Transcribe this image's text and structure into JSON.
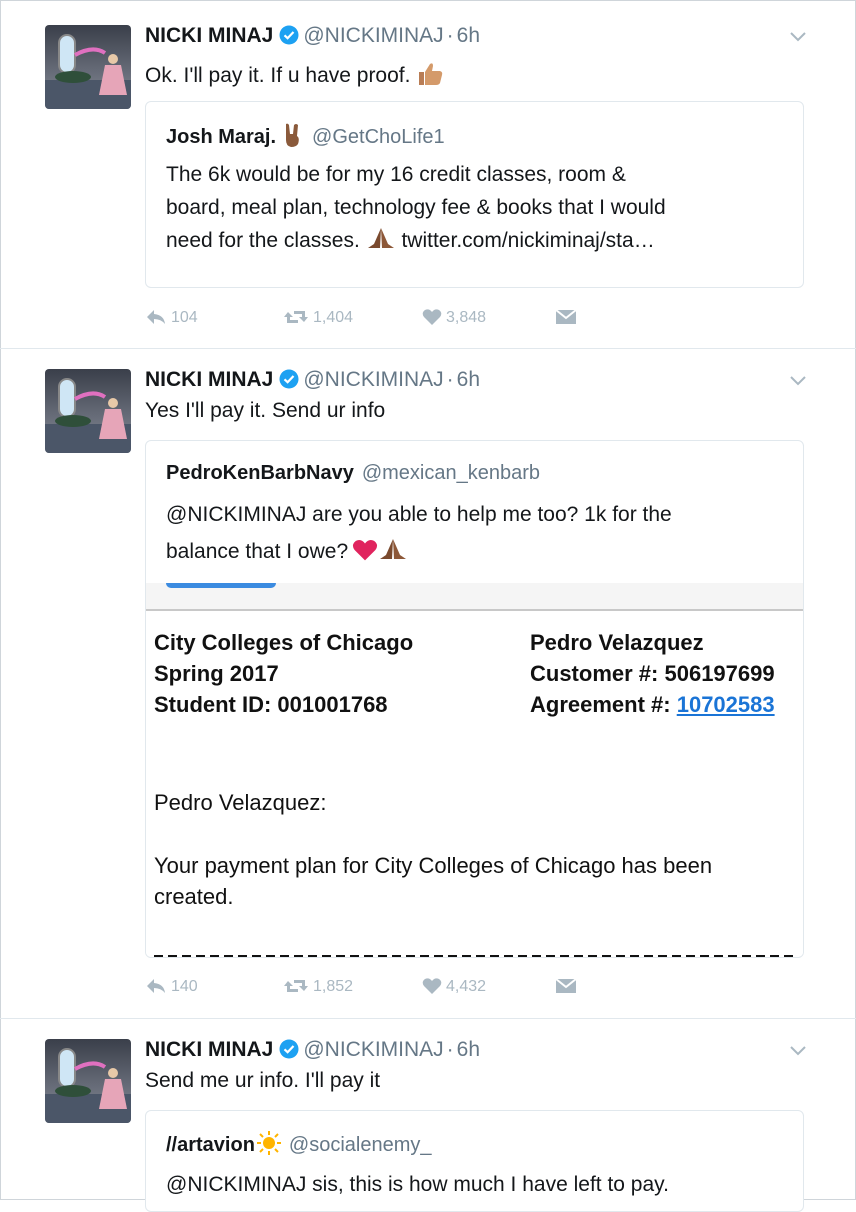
{
  "colors": {
    "verified": "#1da1f2",
    "muted": "#657786",
    "action": "#aab8c2",
    "link": "#1a74d6",
    "heart_red": "#e0245e"
  },
  "tweets": [
    {
      "name": "NICKI MINAJ",
      "handle": "@NICKIMINAJ",
      "dot": "·",
      "time": "6h",
      "text": "Ok. I'll pay it. If u have proof.",
      "emoji": "thumbs-up-icon",
      "quote": {
        "name": "Josh Maraj.",
        "name_emoji": "rock-on-hand-icon",
        "handle": "@GetChoLife1",
        "lines": [
          "The 6k would be for my 16 credit classes, room &",
          "board, meal plan, technology fee & books that I would",
          "need for the classes."
        ],
        "line3_link": "twitter.com/nickiminaj/sta…"
      },
      "replies": "104",
      "retweets": "1,404",
      "likes": "3,848"
    },
    {
      "name": "NICKI MINAJ",
      "handle": "@NICKIMINAJ",
      "dot": "·",
      "time": "6h",
      "text": "Yes I'll pay it. Send ur info",
      "quote": {
        "name": "PedroKenBarbNavy",
        "handle": "@mexican_kenbarb",
        "lines": [
          "@NICKIMINAJ are you able to help me too? 1k for the",
          "balance that I owe?"
        ],
        "doc": {
          "col1": [
            "City Colleges of Chicago",
            "Spring 2017",
            "Student ID: 001001768"
          ],
          "col2_name": "Pedro Velazquez",
          "col2_customer_label": "Customer #:",
          "col2_customer_value": "506197699",
          "col2_agreement_label": "Agreement #:",
          "col2_agreement_value": "10702583",
          "greeting": "Pedro Velazquez:",
          "body": "Your payment plan for City Colleges of Chicago has been created."
        }
      },
      "replies": "140",
      "retweets": "1,852",
      "likes": "4,432"
    },
    {
      "name": "NICKI MINAJ",
      "handle": "@NICKIMINAJ",
      "dot": "·",
      "time": "6h",
      "text": "Send me ur info. I'll pay it",
      "quote": {
        "name": "//artavion",
        "name_emoji": "sun-icon",
        "handle": "@socialenemy_",
        "lines": [
          "@NICKIMINAJ sis, this is how much I have left to pay."
        ]
      }
    }
  ]
}
